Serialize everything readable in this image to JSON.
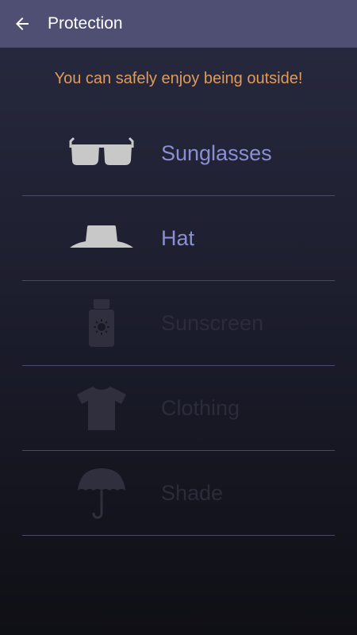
{
  "header": {
    "title": "Protection",
    "back_icon": "arrow-left-icon"
  },
  "message": "You can safely enjoy being outside!",
  "items": [
    {
      "label": "Sunglasses",
      "icon": "sunglasses-icon",
      "active": true
    },
    {
      "label": "Hat",
      "icon": "hat-icon",
      "active": true
    },
    {
      "label": "Sunscreen",
      "icon": "sunscreen-icon",
      "active": false
    },
    {
      "label": "Clothing",
      "icon": "tshirt-icon",
      "active": false
    },
    {
      "label": "Shade",
      "icon": "umbrella-icon",
      "active": false
    }
  ],
  "colors": {
    "appbar": "#4e4f73",
    "message": "#e19a58",
    "active_label": "#8a8fd4",
    "inactive_label": "#2b2c3a",
    "active_icon": "#c8c8c8",
    "inactive_icon": "#2f2f3d"
  }
}
